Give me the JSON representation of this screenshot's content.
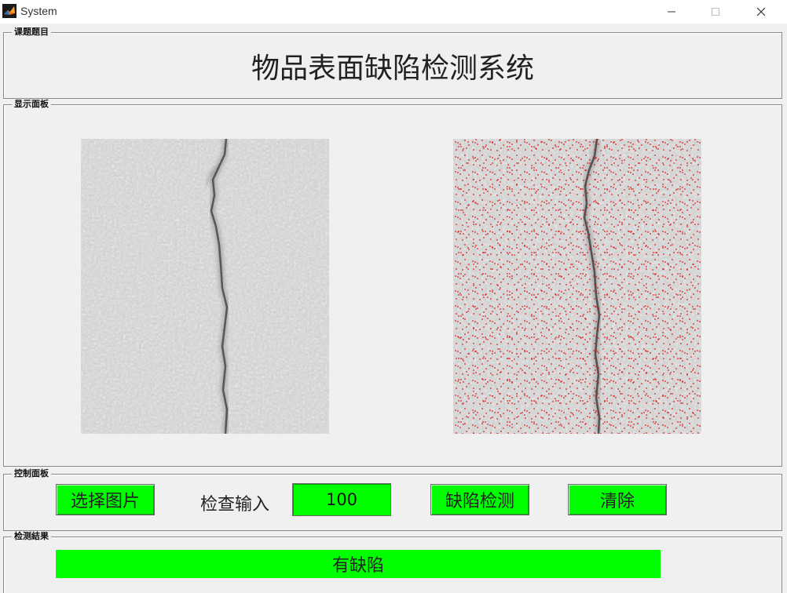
{
  "window": {
    "title": "System"
  },
  "panels": {
    "title_panel_label": "课题题目",
    "display_panel_label": "显示面板",
    "control_panel_label": "控制面板",
    "result_panel_label": "检测結果"
  },
  "page_title": "物品表面缺陷检测系统",
  "controls": {
    "select_image_label": "选择图片",
    "check_input_label": "检查输入",
    "check_input_value": "100",
    "detect_label": "缺陷检测",
    "clear_label": "清除"
  },
  "result": {
    "text": "有缺陷"
  },
  "colors": {
    "button_green": "#00ff00",
    "background": "#f0f0f0",
    "defect_marker": "#e00000"
  },
  "icons": {
    "app": "matlab-logo-icon",
    "minimize": "minimize-icon",
    "maximize": "maximize-icon",
    "close": "close-icon"
  }
}
